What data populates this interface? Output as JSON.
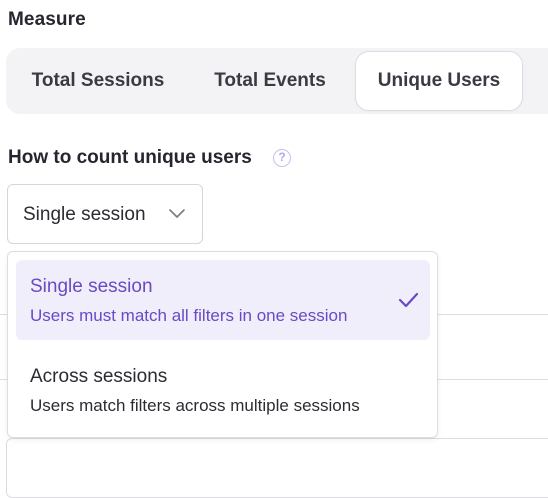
{
  "measure": {
    "title": "Measure",
    "tabs": [
      {
        "label": "Total Sessions",
        "selected": false
      },
      {
        "label": "Total Events",
        "selected": false
      },
      {
        "label": "Unique Users",
        "selected": true
      }
    ]
  },
  "count_field": {
    "label": "How to count unique users",
    "help_icon": "?",
    "selected_value": "Single session"
  },
  "dropdown": {
    "options": [
      {
        "title": "Single session",
        "description": "Users must match all filters in one session",
        "selected": true
      },
      {
        "title": "Across sessions",
        "description": "Users match filters across multiple sessions",
        "selected": false
      }
    ]
  },
  "colors": {
    "accent": "#6a49c4",
    "selected_bg": "#f1eefb",
    "segmented_bg": "#f3f3f6"
  },
  "icons": {
    "help": "question-circle-icon",
    "chevron": "chevron-down-icon",
    "check": "check-icon"
  }
}
